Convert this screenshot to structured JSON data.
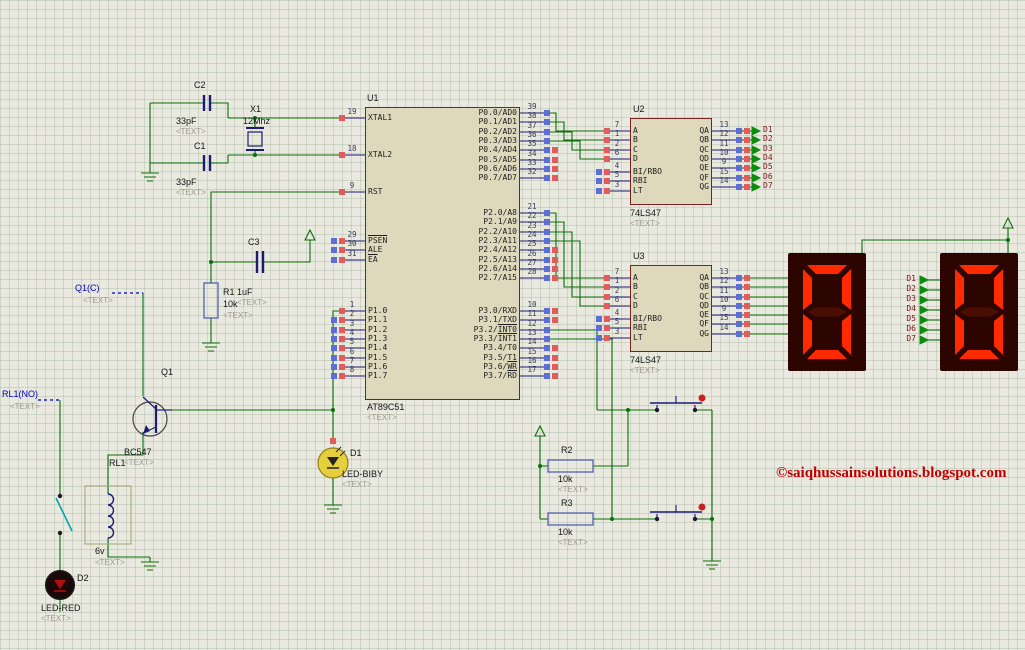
{
  "watermark": "©saiqhussainsolutions.blogspot.com",
  "colors": {
    "wire": "#0a700a",
    "pin": "#1b1b72",
    "chip_fill": "#ded9bc",
    "chip_border": "#7a2121",
    "probe_high": "#e35b5b",
    "probe_low": "#5d6fd6",
    "segment_lit": "#ff2a00",
    "segment_unlit": "#4a0e02",
    "display_body": "#2c0500",
    "label_blue": "#0000c0",
    "watermark_red": "#c00000",
    "text_gray": "#9a9a90"
  },
  "chips": {
    "u1": {
      "ref": "U1",
      "value": "AT89C51",
      "note": "<TEXT>",
      "left_pins": [
        {
          "num": "19",
          "name": "XTAL1"
        },
        {
          "num": "18",
          "name": "XTAL2"
        },
        {
          "num": "9",
          "name": "RST"
        },
        {
          "num": "29",
          "name": "PSEN",
          "bar_all": true
        },
        {
          "num": "30",
          "name": "ALE"
        },
        {
          "num": "31",
          "name": "EA",
          "bar_all": true
        },
        {
          "num": "1",
          "name": "P1.0"
        },
        {
          "num": "2",
          "name": "P1.1"
        },
        {
          "num": "3",
          "name": "P1.2"
        },
        {
          "num": "4",
          "name": "P1.3"
        },
        {
          "num": "5",
          "name": "P1.4"
        },
        {
          "num": "6",
          "name": "P1.5"
        },
        {
          "num": "7",
          "name": "P1.6"
        },
        {
          "num": "8",
          "name": "P1.7"
        }
      ],
      "right_pins": [
        {
          "num": "39",
          "name": "P0.0/AD0"
        },
        {
          "num": "38",
          "name": "P0.1/AD1"
        },
        {
          "num": "37",
          "name": "P0.2/AD2"
        },
        {
          "num": "36",
          "name": "P0.3/AD3"
        },
        {
          "num": "35",
          "name": "P0.4/AD4"
        },
        {
          "num": "34",
          "name": "P0.5/AD5"
        },
        {
          "num": "33",
          "name": "P0.6/AD6"
        },
        {
          "num": "32",
          "name": "P0.7/AD7"
        },
        {
          "num": "21",
          "name": "P2.0/A8"
        },
        {
          "num": "22",
          "name": "P2.1/A9"
        },
        {
          "num": "23",
          "name": "P2.2/A10"
        },
        {
          "num": "24",
          "name": "P2.3/A11"
        },
        {
          "num": "25",
          "name": "P2.4/A12"
        },
        {
          "num": "26",
          "name": "P2.5/A13"
        },
        {
          "num": "27",
          "name": "P2.6/A14"
        },
        {
          "num": "28",
          "name": "P2.7/A15"
        },
        {
          "num": "10",
          "name": "P3.0/RXD"
        },
        {
          "num": "11",
          "name": "P3.1/TXD"
        },
        {
          "num": "12",
          "name": "P3.2/",
          "bar": "INT0"
        },
        {
          "num": "13",
          "name": "P3.3/",
          "bar": "INT1"
        },
        {
          "num": "14",
          "name": "P3.4/T0"
        },
        {
          "num": "15",
          "name": "P3.5/T1"
        },
        {
          "num": "16",
          "name": "P3.6/",
          "bar": "WR"
        },
        {
          "num": "17",
          "name": "P3.7/",
          "bar": "RD"
        }
      ]
    },
    "u2": {
      "ref": "U2",
      "value": "74LS47",
      "note": "<TEXT>",
      "left_pins": [
        {
          "num": "7",
          "name": "A"
        },
        {
          "num": "1",
          "name": "B"
        },
        {
          "num": "2",
          "name": "C"
        },
        {
          "num": "6",
          "name": "D"
        },
        {
          "num": "4",
          "name": "BI/RBO"
        },
        {
          "num": "5",
          "name": "RBI"
        },
        {
          "num": "3",
          "name": "LT"
        }
      ],
      "right_pins": [
        {
          "num": "13",
          "name": "QA"
        },
        {
          "num": "12",
          "name": "QB"
        },
        {
          "num": "11",
          "name": "QC"
        },
        {
          "num": "10",
          "name": "QD"
        },
        {
          "num": "9",
          "name": "QE"
        },
        {
          "num": "15",
          "name": "QF"
        },
        {
          "num": "14",
          "name": "QG"
        }
      ]
    },
    "u3": {
      "ref": "U3",
      "value": "74LS47",
      "note": "<TEXT>",
      "left_pins": [
        {
          "num": "7",
          "name": "A"
        },
        {
          "num": "1",
          "name": "B"
        },
        {
          "num": "2",
          "name": "C"
        },
        {
          "num": "6",
          "name": "D"
        },
        {
          "num": "4",
          "name": "BI/RBO"
        },
        {
          "num": "5",
          "name": "RBI"
        },
        {
          "num": "3",
          "name": "LT"
        }
      ],
      "right_pins": [
        {
          "num": "13",
          "name": "QA"
        },
        {
          "num": "12",
          "name": "QB"
        },
        {
          "num": "11",
          "name": "QC"
        },
        {
          "num": "10",
          "name": "QD"
        },
        {
          "num": "9",
          "name": "QE"
        },
        {
          "num": "15",
          "name": "QF"
        },
        {
          "num": "14",
          "name": "QG"
        }
      ]
    }
  },
  "parts": {
    "c2": {
      "ref": "C2",
      "value": "33pF",
      "note": "<TEXT>"
    },
    "c1": {
      "ref": "C1",
      "value": "33pF",
      "note": "<TEXT>"
    },
    "x1": {
      "ref": "X1",
      "value": "12Mhz"
    },
    "c3": {
      "ref": "C3",
      "value": "1uF",
      "note": "<TEXT>"
    },
    "r1": {
      "ref": "R1",
      "value": "10k",
      "note": "<TEXT>"
    },
    "r2": {
      "ref": "R2",
      "value": "10k",
      "note": "<TEXT>"
    },
    "r3": {
      "ref": "R3",
      "value": "10k",
      "note": "<TEXT>"
    },
    "q1": {
      "ref": "Q1",
      "value": "BC547",
      "note": "<TEXT>"
    },
    "rl1": {
      "ref": "RL1",
      "value": "6v",
      "note": "<TEXT>"
    },
    "d1": {
      "ref": "D1",
      "value": "LED-BIBY",
      "note": "<TEXT>"
    },
    "d2": {
      "ref": "D2",
      "value": "LED-RED",
      "note": "<TEXT>"
    }
  },
  "probes": {
    "q1c": {
      "label": "Q1(C)",
      "note": "<TEXT>"
    },
    "rl1no": {
      "label": "RL1(NO)",
      "note": "<TEXT>"
    }
  },
  "net_labels": [
    "D1",
    "D2",
    "D3",
    "D4",
    "D5",
    "D6",
    "D7"
  ],
  "displays": [
    {
      "digit": "0",
      "lit_segments": "abcdef"
    },
    {
      "digit": "0",
      "lit_segments": "abcdef"
    }
  ]
}
